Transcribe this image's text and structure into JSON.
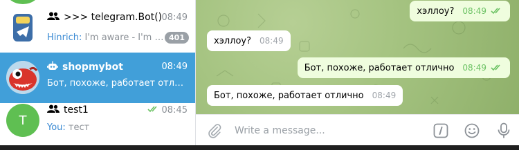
{
  "chats": [
    {
      "name": ">>> telegram.Bot()",
      "time": "08:49",
      "sender": "Hinrich:",
      "preview": " I'm aware - I'm th...",
      "unread": "401"
    },
    {
      "name": "shopmybot",
      "time": "08:49",
      "preview": "Бот, похоже, работает отлично"
    },
    {
      "name": "test1",
      "time": "08:45",
      "sender": "You:",
      "preview": " тест",
      "avatar_letter": "T"
    }
  ],
  "messages": [
    {
      "direction": "out",
      "text": "хэллоу?",
      "time": "08:49"
    },
    {
      "direction": "in",
      "text": "хэллоу?",
      "time": "08:49"
    },
    {
      "direction": "out",
      "text": "Бот, похоже, работает отлично",
      "time": "08:49"
    },
    {
      "direction": "in",
      "text": "Бот, похоже, работает отлично",
      "time": "08:49"
    }
  ],
  "composer": {
    "placeholder": "Write a message..."
  },
  "icons": {
    "attach": "paperclip-icon",
    "commands": "slash-command-icon",
    "emoji": "smiley-icon",
    "voice": "microphone-icon",
    "group": "group-icon",
    "bot": "bot-icon",
    "read": "double-check-icon"
  },
  "colors": {
    "accent": "#419fd9",
    "outgoing_bubble": "#effdde",
    "read_check": "#6cc264",
    "badge": "#9aa0a6",
    "avatar_test1": "#5fbf52"
  }
}
